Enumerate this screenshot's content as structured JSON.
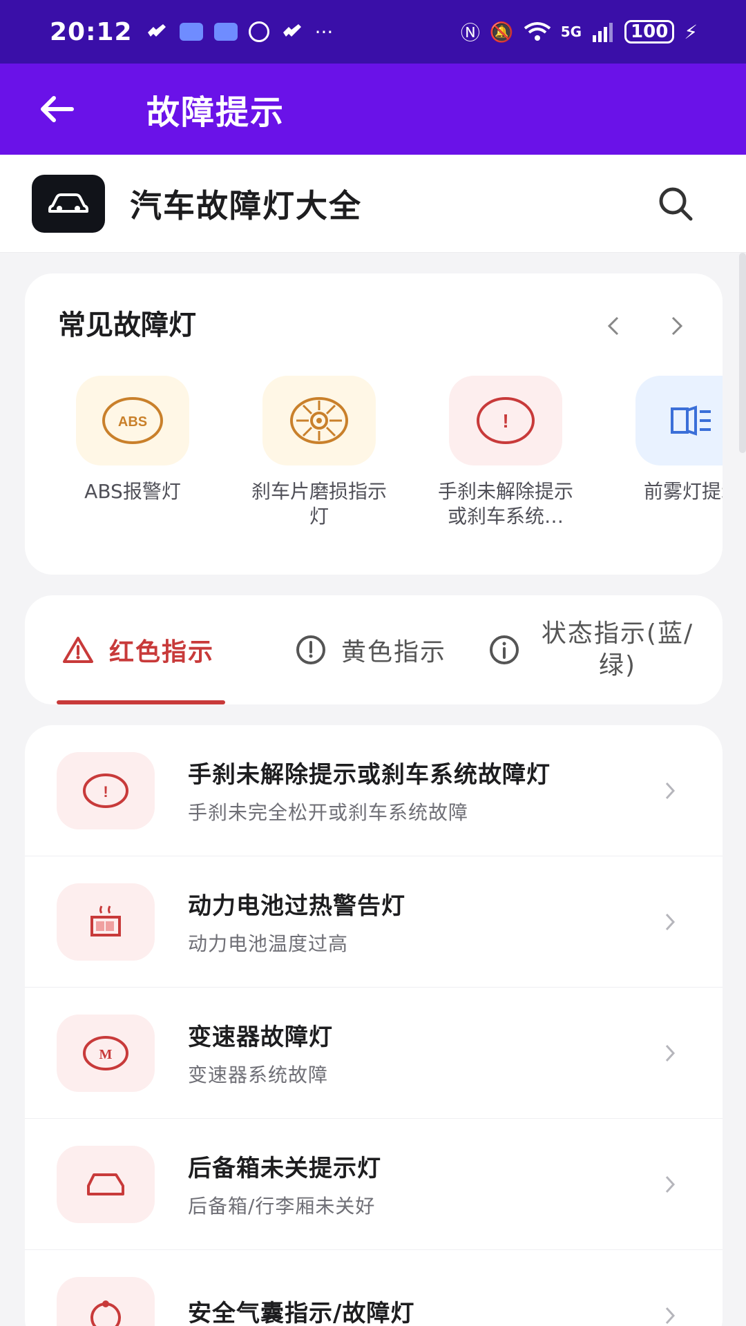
{
  "status_bar": {
    "time": "20:12",
    "network": "5G",
    "battery": "100"
  },
  "app_bar": {
    "title": "故障提示",
    "back_icon": "arrow-left-icon"
  },
  "header": {
    "site_title": "汽车故障灯大全",
    "logo_icon": "car-icon",
    "search_icon": "search-icon"
  },
  "common": {
    "title": "常见故障灯",
    "items": [
      {
        "label": "ABS报警灯",
        "icon": "abs-icon",
        "color": "#c9802b"
      },
      {
        "label": "刹车片磨损指示灯",
        "icon": "brake-pad-icon",
        "color": "#c9802b"
      },
      {
        "label": "手刹未解除提示或刹车系统…",
        "icon": "brake-warning-icon",
        "color": "#c83a3a"
      },
      {
        "label": "前雾灯提示",
        "icon": "fog-light-icon",
        "color": "#3b6fd8"
      }
    ]
  },
  "tabs": [
    {
      "label": "红色指示",
      "icon": "warning-triangle-icon"
    },
    {
      "label": "黄色指示",
      "icon": "exclamation-circle-icon"
    },
    {
      "label": "状态指示(蓝/绿)",
      "icon": "info-circle-icon"
    }
  ],
  "faults": [
    {
      "title": "手刹未解除提示或刹车系统故障灯",
      "desc": "手刹未完全松开或刹车系统故障",
      "icon": "brake-warning-icon"
    },
    {
      "title": "动力电池过热警告灯",
      "desc": "动力电池温度过高",
      "icon": "battery-heat-icon"
    },
    {
      "title": "变速器故障灯",
      "desc": "变速器系统故障",
      "icon": "transmission-icon"
    },
    {
      "title": "后备箱未关提示灯",
      "desc": "后备箱/行李厢未关好",
      "icon": "trunk-icon"
    },
    {
      "title": "安全气囊指示/故障灯",
      "desc": "",
      "icon": "airbag-icon"
    }
  ],
  "colors": {
    "status_bar": "#3a0fa8",
    "app_bar": "#6a12e8",
    "accent_red": "#c83a3a"
  }
}
